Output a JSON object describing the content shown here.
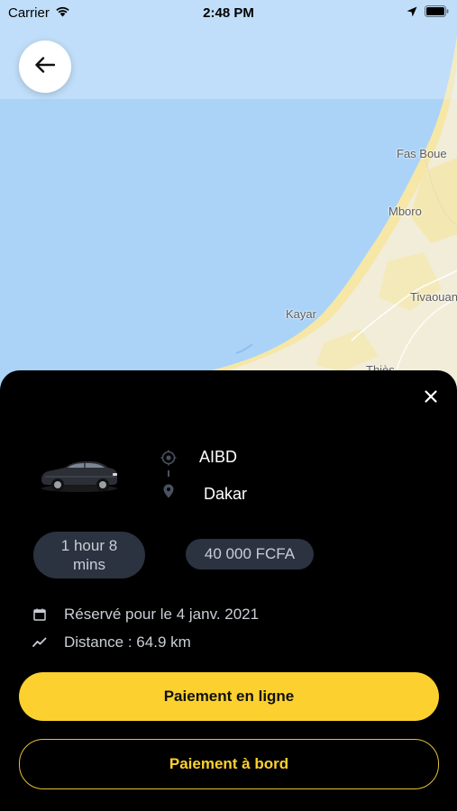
{
  "status_bar": {
    "carrier": "Carrier",
    "time": "2:48 PM"
  },
  "map": {
    "labels": [
      "Fas Boue",
      "Mboro",
      "Tivaouane",
      "Kayar",
      "Thiès"
    ]
  },
  "trip": {
    "origin": "AIBD",
    "destination": "Dakar",
    "duration": "1 hour 8 mins",
    "price": "40 000 FCFA",
    "reserved": "Réservé pour le 4 janv. 2021",
    "distance": "Distance : 64.9 km"
  },
  "actions": {
    "pay_online": "Paiement en ligne",
    "pay_on_board": "Paiement à bord"
  },
  "colors": {
    "accent": "#fcd12f",
    "sheet_bg": "#000000",
    "pill_bg": "#2b3240",
    "sea": "#aad3f7",
    "land": "#f2edd8"
  },
  "icons": [
    "wifi-icon",
    "location-arrow-icon",
    "battery-icon",
    "back-arrow-icon",
    "close-icon",
    "car-icon",
    "origin-target-icon",
    "destination-pin-icon",
    "calendar-icon",
    "trend-icon"
  ]
}
